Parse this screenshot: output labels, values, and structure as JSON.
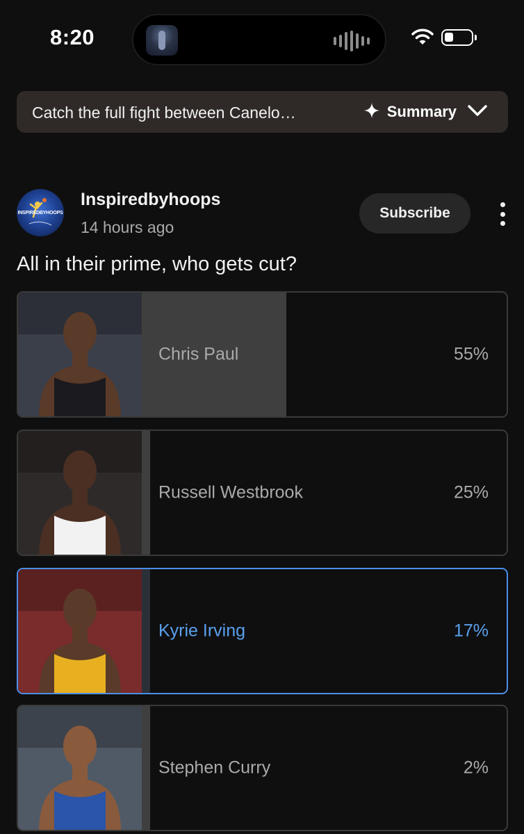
{
  "status_bar": {
    "time": "8:20"
  },
  "summary": {
    "text": "Catch the full fight between Canelo…",
    "button_label": "Summary"
  },
  "post": {
    "channel_name": "Inspiredbyhoops",
    "avatar_text": "INSPIREDBYHOOPS",
    "timestamp": "14 hours ago",
    "subscribe_label": "Subscribe",
    "question": "All in their prime, who gets cut?"
  },
  "poll": {
    "options": [
      {
        "name": "Chris Paul",
        "percent_label": "55%",
        "percent": 55,
        "selected": false,
        "jersey_color": "#1a1a1f",
        "skin": "#5a3a28",
        "bg": "#3b3f4a"
      },
      {
        "name": "Russell Westbrook",
        "percent_label": "25%",
        "percent": 25,
        "selected": false,
        "jersey_color": "#f2f2f2",
        "skin": "#4a2f22",
        "bg": "#2f2a2a"
      },
      {
        "name": "Kyrie Irving",
        "percent_label": "17%",
        "percent": 17,
        "selected": true,
        "jersey_color": "#e8b021",
        "skin": "#5a3a28",
        "bg": "#7a2b2b"
      },
      {
        "name": "Stephen Curry",
        "percent_label": "2%",
        "percent": 2,
        "selected": false,
        "jersey_color": "#2a55a8",
        "skin": "#8a5a3c",
        "bg": "#505a66"
      }
    ]
  },
  "colors": {
    "background": "#0f0f0f",
    "selected_accent": "#4b8fe8",
    "bar_fill": "#3f3f3f"
  }
}
